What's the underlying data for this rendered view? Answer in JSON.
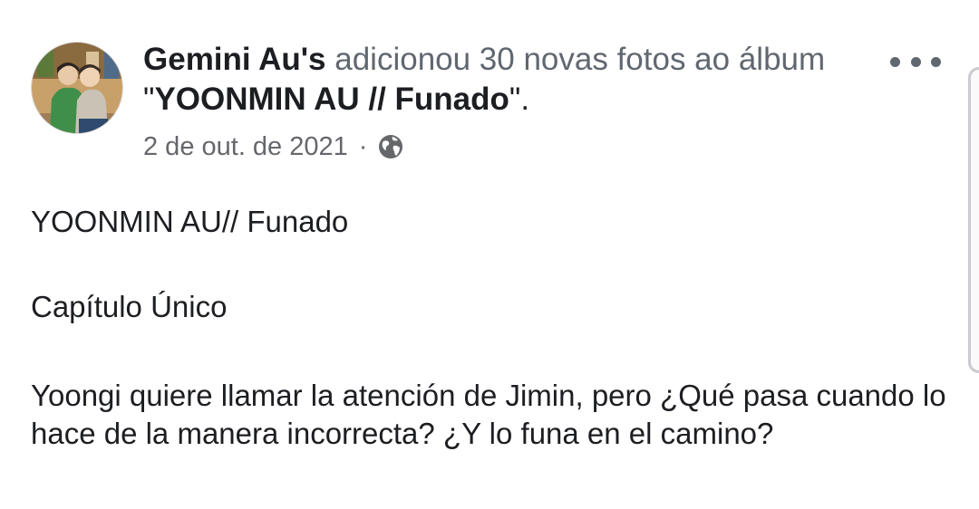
{
  "post": {
    "author": "Gemini Au's",
    "action": " adicionou 30 novas fotos ao álbum",
    "album_prefix": "\"",
    "album_name": "YOONMIN AU // Funado",
    "album_suffix": "\".",
    "date": "2 de out. de 2021",
    "separator": "·",
    "audience_icon": "globe-icon",
    "more_icon": "more-options-icon",
    "paragraphs": [
      "YOONMIN AU// Funado",
      "Capítulo Único",
      "Yoongi  quiere llamar la atención de Jimin, pero ¿Qué pasa cuando lo hace de la manera incorrecta? ¿Y lo funa en el camino?"
    ]
  },
  "colors": {
    "primary_text": "#1c1e21",
    "secondary_text": "#65676b",
    "icon_gray": "#606770",
    "background": "#ffffff"
  }
}
